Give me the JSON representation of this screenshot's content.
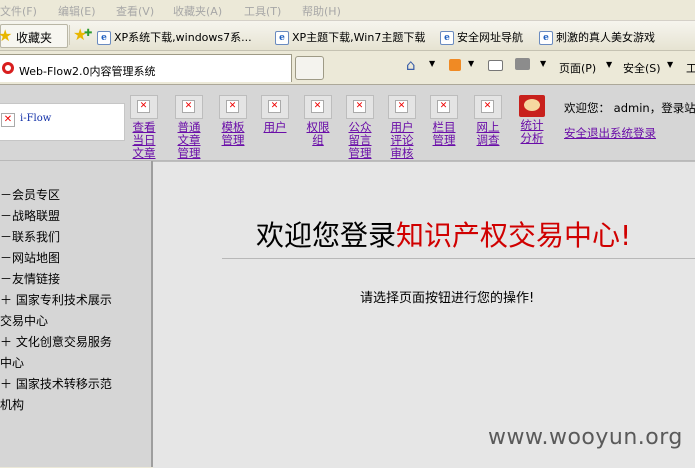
{
  "menubar": [
    "文件(F)",
    "编辑(E)",
    "查看(V)",
    "收藏夹(A)",
    "工具(T)",
    "帮助(H)"
  ],
  "favorites": {
    "button_label": "收藏夹",
    "items": [
      "XP系统下载,windows7系...",
      "XP主题下载,Win7主题下载",
      "安全网址导航",
      "刺激的真人美女游戏"
    ]
  },
  "tab": {
    "title": "Web-Flow2.0内容管理系统"
  },
  "commandbar": {
    "page": "页面(P)",
    "safety": "安全(S)",
    "tools_short": "工"
  },
  "brand": {
    "name": "i-Flow"
  },
  "nav": [
    {
      "label": [
        "查看",
        "当日",
        "文章"
      ]
    },
    {
      "label": [
        "普通",
        "文章",
        "管理"
      ]
    },
    {
      "label": [
        "模板",
        "管理"
      ]
    },
    {
      "label": [
        "用户"
      ]
    },
    {
      "label": [
        "权限",
        "组"
      ]
    },
    {
      "label": [
        "公众",
        "留言",
        "管理"
      ]
    },
    {
      "label": [
        "用户",
        "评论",
        "审核"
      ]
    },
    {
      "label": [
        "栏目",
        "管理"
      ]
    },
    {
      "label": [
        "网上",
        "调查"
      ]
    },
    {
      "label": [
        "统计",
        "分析"
      ]
    }
  ],
  "header": {
    "welcome": "欢迎您： admin，登录站",
    "logout": "安全退出系统登录"
  },
  "sidebar": [
    "－会员专区",
    "－战略联盟",
    "－联系我们",
    "－网站地图",
    "－友情链接",
    "＋ 国家专利技术展示",
    "交易中心",
    "＋ 文化创意交易服务",
    "中心",
    "＋ 国家技术转移示范",
    "机构"
  ],
  "main": {
    "title_black": "欢迎您登录",
    "title_red": "知识产权交易中心!",
    "subtitle": "请选择页面按钮进行您的操作!"
  },
  "watermark": "www.wooyun.org"
}
